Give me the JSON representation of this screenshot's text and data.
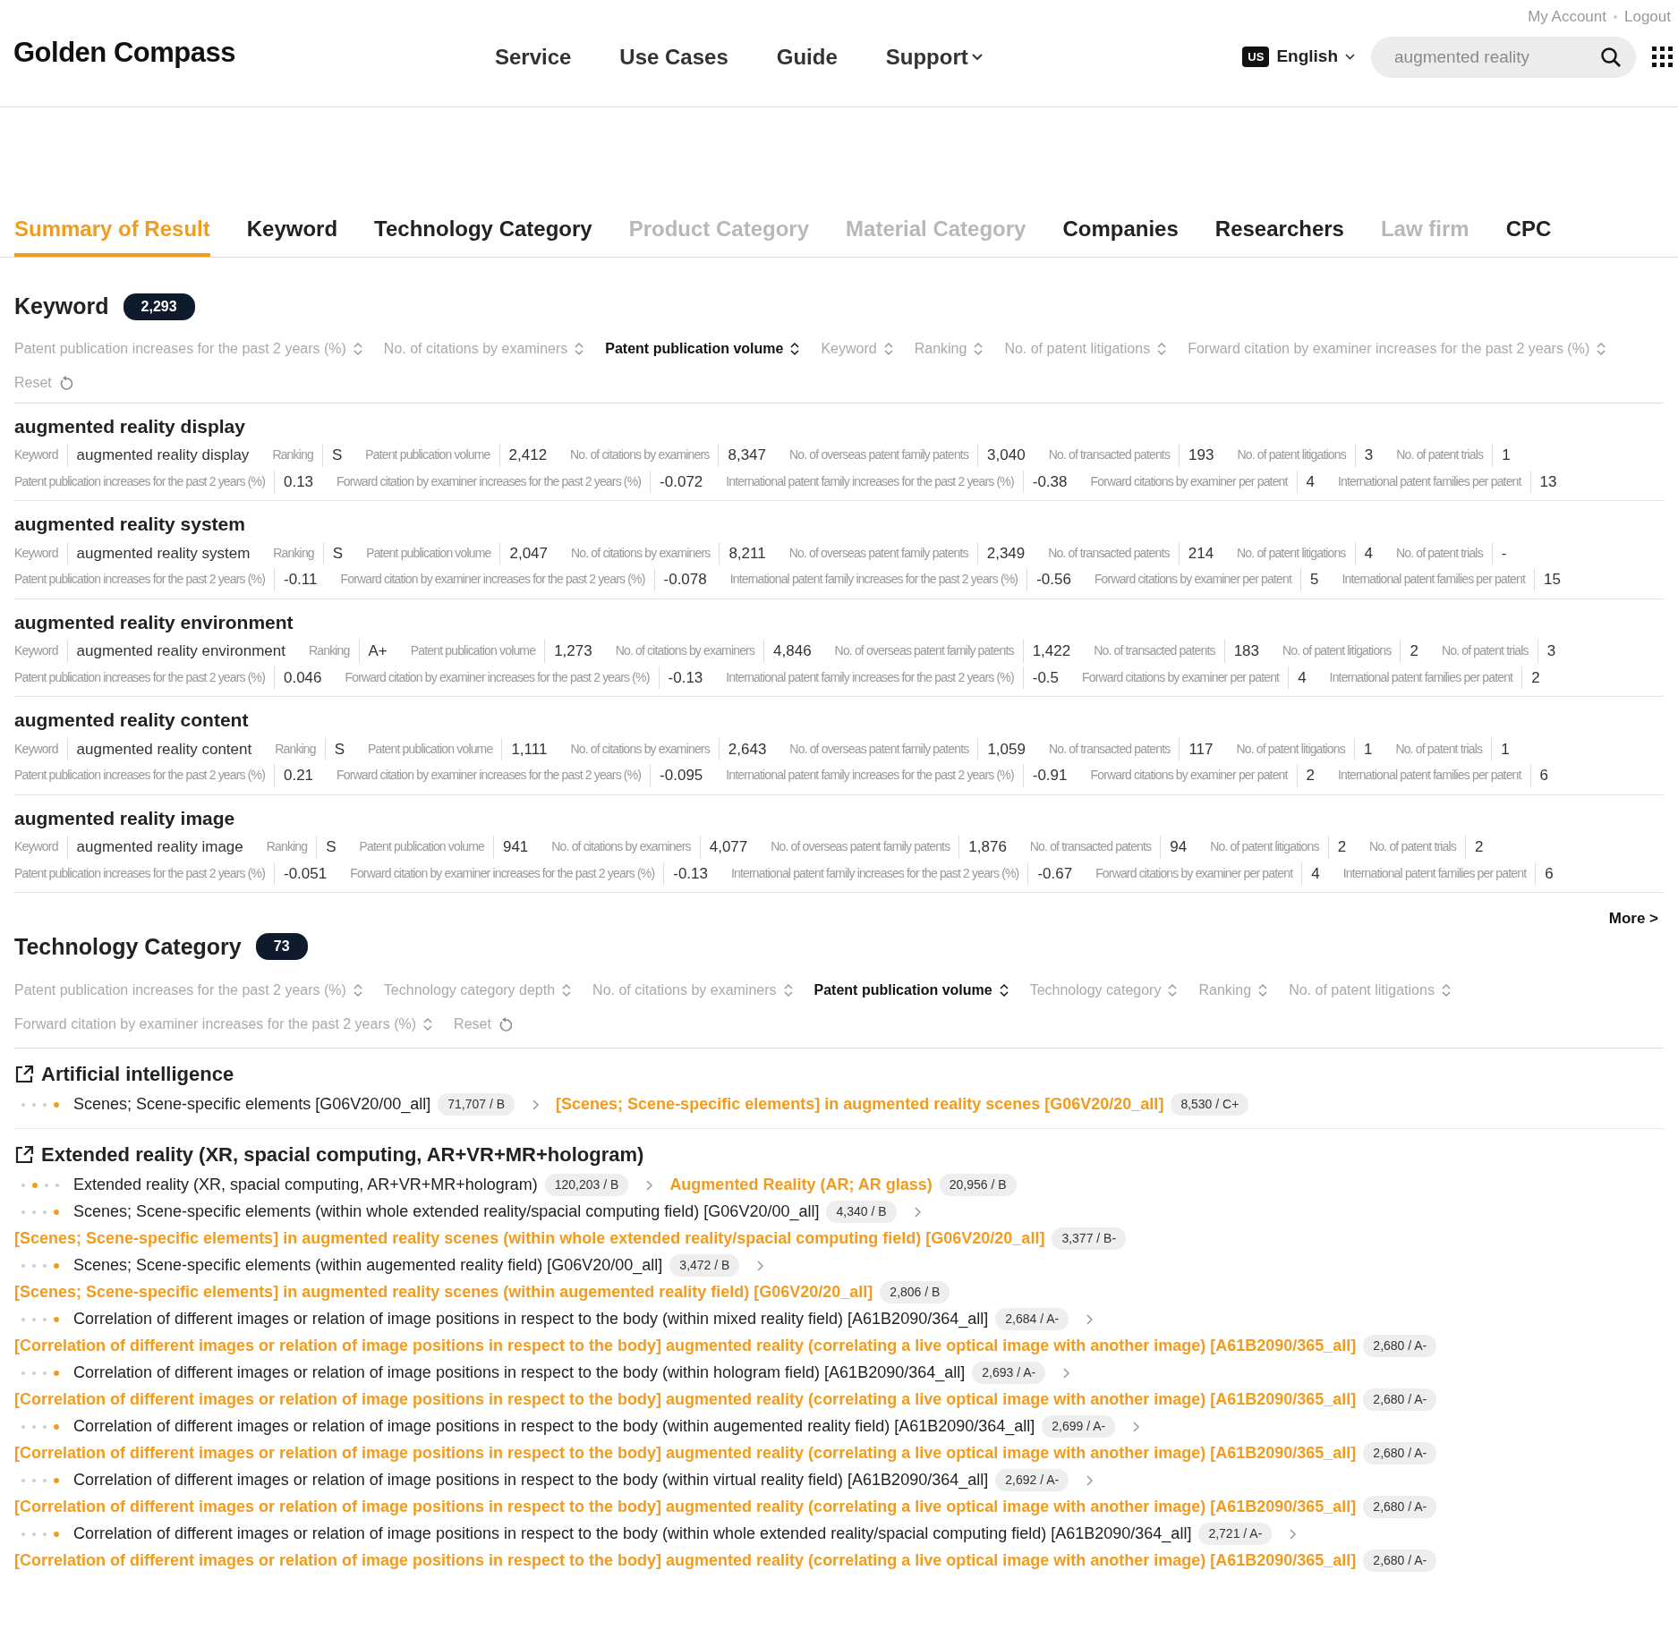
{
  "top_links": [
    "My Account",
    "Logout"
  ],
  "logo": "Golden Compass",
  "nav": [
    {
      "label": "Service",
      "dropdown": false
    },
    {
      "label": "Use Cases",
      "dropdown": false
    },
    {
      "label": "Guide",
      "dropdown": false
    },
    {
      "label": "Support",
      "dropdown": true
    }
  ],
  "language": {
    "flag": "US",
    "label": "English"
  },
  "search": {
    "placeholder": "augmented reality"
  },
  "tabs": [
    {
      "label": "Summary of Result",
      "selected": true,
      "disabled": false
    },
    {
      "label": "Keyword",
      "selected": false,
      "disabled": false
    },
    {
      "label": "Technology Category",
      "selected": false,
      "disabled": false
    },
    {
      "label": "Product Category",
      "selected": false,
      "disabled": true
    },
    {
      "label": "Material Category",
      "selected": false,
      "disabled": true
    },
    {
      "label": "Companies",
      "selected": false,
      "disabled": false
    },
    {
      "label": "Researchers",
      "selected": false,
      "disabled": false
    },
    {
      "label": "Law firm",
      "selected": false,
      "disabled": true
    },
    {
      "label": "CPC",
      "selected": false,
      "disabled": false
    }
  ],
  "keyword_section": {
    "title": "Keyword",
    "count": "2,293",
    "sort_options": [
      {
        "label": "Patent publication increases for the past 2 years (%)",
        "selected": false
      },
      {
        "label": "No. of citations by examiners",
        "selected": false
      },
      {
        "label": "Patent publication volume",
        "selected": true
      },
      {
        "label": "Keyword",
        "selected": false
      },
      {
        "label": "Ranking",
        "selected": false
      },
      {
        "label": "No. of patent litigations",
        "selected": false
      },
      {
        "label": "Forward citation by examiner increases for the past 2 years (%)",
        "selected": false
      }
    ],
    "reset": "Reset",
    "results": [
      {
        "title": "augmented reality display",
        "line_1": [
          {
            "label": "Keyword",
            "value": "augmented reality display"
          },
          {
            "label": "Ranking",
            "value": "S"
          },
          {
            "label": "Patent publication volume",
            "value": "2,412"
          },
          {
            "label": "No. of citations by examiners",
            "value": "8,347"
          },
          {
            "label": "No. of overseas patent family patents",
            "value": "3,040"
          },
          {
            "label": "No. of transacted patents",
            "value": "193"
          },
          {
            "label": "No. of patent litigations",
            "value": "3"
          },
          {
            "label": "No. of patent trials",
            "value": "1"
          }
        ],
        "line_2": [
          {
            "label": "Patent publication increases for the past 2 years (%)",
            "value": "0.13"
          },
          {
            "label": "Forward citation by examiner increases for the past 2 years (%)",
            "value": "-0.072"
          },
          {
            "label": "International patent family increases for the past 2 years (%)",
            "value": "-0.38"
          },
          {
            "label": "Forward citations by examiner per patent",
            "value": "4"
          },
          {
            "label": "International patent families per patent",
            "value": "13"
          }
        ]
      },
      {
        "title": "augmented reality system",
        "line_1": [
          {
            "label": "Keyword",
            "value": "augmented reality system"
          },
          {
            "label": "Ranking",
            "value": "S"
          },
          {
            "label": "Patent publication volume",
            "value": "2,047"
          },
          {
            "label": "No. of citations by examiners",
            "value": "8,211"
          },
          {
            "label": "No. of overseas patent family patents",
            "value": "2,349"
          },
          {
            "label": "No. of transacted patents",
            "value": "214"
          },
          {
            "label": "No. of patent litigations",
            "value": "4"
          },
          {
            "label": "No. of patent trials",
            "value": "-"
          }
        ],
        "line_2": [
          {
            "label": "Patent publication increases for the past 2 years (%)",
            "value": "-0.11"
          },
          {
            "label": "Forward citation by examiner increases for the past 2 years (%)",
            "value": "-0.078"
          },
          {
            "label": "International patent family increases for the past 2 years (%)",
            "value": "-0.56"
          },
          {
            "label": "Forward citations by examiner per patent",
            "value": "5"
          },
          {
            "label": "International patent families per patent",
            "value": "15"
          }
        ]
      },
      {
        "title": "augmented reality environment",
        "line_1": [
          {
            "label": "Keyword",
            "value": "augmented reality environment"
          },
          {
            "label": "Ranking",
            "value": "A+"
          },
          {
            "label": "Patent publication volume",
            "value": "1,273"
          },
          {
            "label": "No. of citations by examiners",
            "value": "4,846"
          },
          {
            "label": "No. of overseas patent family patents",
            "value": "1,422"
          },
          {
            "label": "No. of transacted patents",
            "value": "183"
          },
          {
            "label": "No. of patent litigations",
            "value": "2"
          },
          {
            "label": "No. of patent trials",
            "value": "3"
          }
        ],
        "line_2": [
          {
            "label": "Patent publication increases for the past 2 years (%)",
            "value": "0.046"
          },
          {
            "label": "Forward citation by examiner increases for the past 2 years (%)",
            "value": "-0.13"
          },
          {
            "label": "International patent family increases for the past 2 years (%)",
            "value": "-0.5"
          },
          {
            "label": "Forward citations by examiner per patent",
            "value": "4"
          },
          {
            "label": "International patent families per patent",
            "value": "2"
          }
        ]
      },
      {
        "title": "augmented reality content",
        "line_1": [
          {
            "label": "Keyword",
            "value": "augmented reality content"
          },
          {
            "label": "Ranking",
            "value": "S"
          },
          {
            "label": "Patent publication volume",
            "value": "1,111"
          },
          {
            "label": "No. of citations by examiners",
            "value": "2,643"
          },
          {
            "label": "No. of overseas patent family patents",
            "value": "1,059"
          },
          {
            "label": "No. of transacted patents",
            "value": "117"
          },
          {
            "label": "No. of patent litigations",
            "value": "1"
          },
          {
            "label": "No. of patent trials",
            "value": "1"
          }
        ],
        "line_2": [
          {
            "label": "Patent publication increases for the past 2 years (%)",
            "value": "0.21"
          },
          {
            "label": "Forward citation by examiner increases for the past 2 years (%)",
            "value": "-0.095"
          },
          {
            "label": "International patent family increases for the past 2 years (%)",
            "value": "-0.91"
          },
          {
            "label": "Forward citations by examiner per patent",
            "value": "2"
          },
          {
            "label": "International patent families per patent",
            "value": "6"
          }
        ]
      },
      {
        "title": "augmented reality image",
        "line_1": [
          {
            "label": "Keyword",
            "value": "augmented reality image"
          },
          {
            "label": "Ranking",
            "value": "S"
          },
          {
            "label": "Patent publication volume",
            "value": "941"
          },
          {
            "label": "No. of citations by examiners",
            "value": "4,077"
          },
          {
            "label": "No. of overseas patent family patents",
            "value": "1,876"
          },
          {
            "label": "No. of transacted patents",
            "value": "94"
          },
          {
            "label": "No. of patent litigations",
            "value": "2"
          },
          {
            "label": "No. of patent trials",
            "value": "2"
          }
        ],
        "line_2": [
          {
            "label": "Patent publication increases for the past 2 years (%)",
            "value": "-0.051"
          },
          {
            "label": "Forward citation by examiner increases for the past 2 years (%)",
            "value": "-0.13"
          },
          {
            "label": "International patent family increases for the past 2 years (%)",
            "value": "-0.67"
          },
          {
            "label": "Forward citations by examiner per patent",
            "value": "4"
          },
          {
            "label": "International patent families per patent",
            "value": "6"
          }
        ]
      }
    ],
    "more": "More >"
  },
  "technology_section": {
    "title": "Technology Category",
    "count": "73",
    "sort_options": [
      {
        "label": "Patent publication increases for the past 2 years (%)",
        "selected": false
      },
      {
        "label": "Technology category depth",
        "selected": false
      },
      {
        "label": "No. of citations by examiners",
        "selected": false
      },
      {
        "label": "Patent publication volume",
        "selected": true
      },
      {
        "label": "Technology category",
        "selected": false
      },
      {
        "label": "Ranking",
        "selected": false
      },
      {
        "label": "No. of patent litigations",
        "selected": false
      },
      {
        "label": "Forward citation by examiner increases for the past 2 years (%)",
        "selected": false
      }
    ],
    "reset": "Reset",
    "categories": [
      {
        "title": "Artificial intelligence",
        "links": [
          {
            "dots": [
              false,
              false,
              false,
              true
            ],
            "source": {
              "text": "Scenes; Scene-specific elements [G06V20/00_all]",
              "badge": "71,707 / B"
            },
            "target": {
              "text": "[Scenes; Scene-specific elements] in augmented reality scenes [G06V20/20_all]",
              "badge": "8,530 / C+"
            }
          }
        ]
      },
      {
        "title": "Extended reality (XR, spacial computing, AR+VR+MR+hologram)",
        "links": [
          {
            "dots": [
              false,
              true,
              false,
              false
            ],
            "source": {
              "text": "Extended reality (XR, spacial computing, AR+VR+MR+hologram)",
              "badge": "120,203 / B"
            },
            "target": {
              "text": "Augmented Reality (AR; AR glass)",
              "badge": "20,956 / B"
            }
          },
          {
            "dots": [
              false,
              false,
              false,
              true
            ],
            "source": {
              "text": "Scenes; Scene-specific elements (within whole extended reality/spacial computing field) [G06V20/00_all]",
              "badge": "4,340 / B"
            },
            "target": {
              "text": "[Scenes; Scene-specific elements] in augmented reality scenes (within whole extended reality/spacial computing field) [G06V20/20_all]",
              "badge": "3,377 / B-"
            }
          },
          {
            "dots": [
              false,
              false,
              false,
              true
            ],
            "source": {
              "text": "Scenes; Scene-specific elements (within augemented reality field) [G06V20/00_all]",
              "badge": "3,472 / B"
            },
            "target": {
              "text": "[Scenes; Scene-specific elements] in augmented reality scenes (within augemented reality field) [G06V20/20_all]",
              "badge": "2,806 / B"
            }
          },
          {
            "dots": [
              false,
              false,
              false,
              true
            ],
            "source": {
              "text": "Correlation of different images or relation of image positions in respect to the body (within mixed reality field) [A61B2090/364_all]",
              "badge": "2,684 / A-"
            },
            "target": {
              "text": "[Correlation of different images or relation of image positions in respect to the body] augmented reality (correlating a live optical image with another image) [A61B2090/365_all]",
              "badge": "2,680 / A-"
            }
          },
          {
            "dots": [
              false,
              false,
              false,
              true
            ],
            "source": {
              "text": "Correlation of different images or relation of image positions in respect to the body (within hologram field) [A61B2090/364_all]",
              "badge": "2,693 / A-"
            },
            "target": {
              "text": "[Correlation of different images or relation of image positions in respect to the body] augmented reality (correlating a live optical image with another image) [A61B2090/365_all]",
              "badge": "2,680 / A-"
            }
          },
          {
            "dots": [
              false,
              false,
              false,
              true
            ],
            "source": {
              "text": "Correlation of different images or relation of image positions in respect to the body (within augemented reality field) [A61B2090/364_all]",
              "badge": "2,699 / A-"
            },
            "target": {
              "text": "[Correlation of different images or relation of image positions in respect to the body] augmented reality (correlating a live optical image with another image) [A61B2090/365_all]",
              "badge": "2,680 / A-"
            }
          },
          {
            "dots": [
              false,
              false,
              false,
              true
            ],
            "source": {
              "text": "Correlation of different images or relation of image positions in respect to the body (within virtual reality field) [A61B2090/364_all]",
              "badge": "2,692 / A-"
            },
            "target": {
              "text": "[Correlation of different images or relation of image positions in respect to the body] augmented reality (correlating a live optical image with another image) [A61B2090/365_all]",
              "badge": "2,680 / A-"
            }
          },
          {
            "dots": [
              false,
              false,
              false,
              true
            ],
            "source": {
              "text": "Correlation of different images or relation of image positions in respect to the body (within whole extended reality/spacial computing field) [A61B2090/364_all]",
              "badge": "2,721 / A-"
            },
            "target": {
              "text": "[Correlation of different images or relation of image positions in respect to the body] augmented reality (correlating a live optical image with another image) [A61B2090/365_all]",
              "badge": "2,680 / A-"
            }
          }
        ]
      }
    ]
  }
}
